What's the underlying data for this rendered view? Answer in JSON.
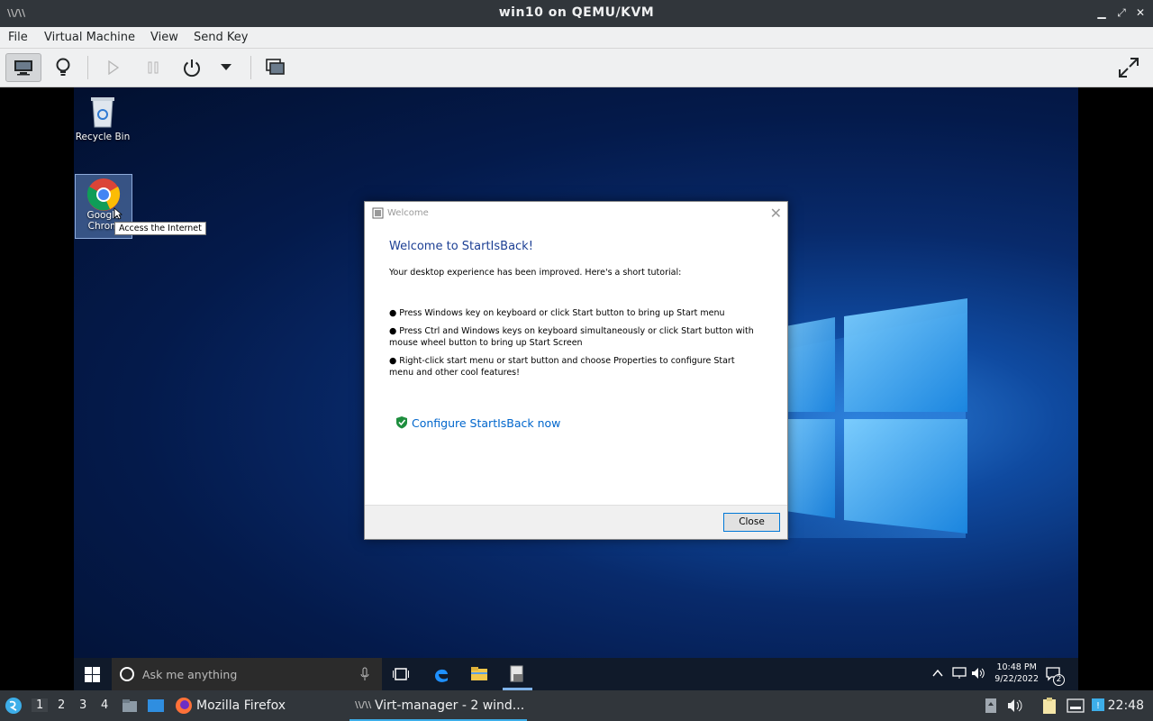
{
  "window": {
    "title": "win10 on QEMU/KVM"
  },
  "menubar": {
    "items": [
      "File",
      "Virtual Machine",
      "View",
      "Send Key"
    ]
  },
  "desktop": {
    "icons": [
      {
        "label": "Recycle Bin"
      },
      {
        "label": "Google Chrome",
        "label_line1": "Google",
        "label_line2": "Chrom"
      }
    ],
    "tooltip": "Access the Internet"
  },
  "dialog": {
    "title": "Welcome",
    "heading": "Welcome to StartIsBack!",
    "intro": "Your desktop experience has been improved. Here's a short tutorial:",
    "bullets": [
      "● Press Windows key on keyboard or click Start button to bring up Start menu",
      "● Press Ctrl and Windows keys on keyboard simultaneously or click Start button with mouse wheel button to bring up Start Screen",
      "● Right-click start menu or start button and choose Properties to configure Start menu and other cool features!"
    ],
    "link": "Configure StartIsBack now",
    "close_label": "Close"
  },
  "win_taskbar": {
    "search_placeholder": "Ask me anything",
    "time": "10:48 PM",
    "date": "9/22/2022",
    "notification_count": "2"
  },
  "host_panel": {
    "workspaces": [
      "1",
      "2",
      "3",
      "4"
    ],
    "current_workspace": "1",
    "tasks": [
      {
        "label": "Mozilla Firefox"
      },
      {
        "label": "Virt-manager - 2 wind..."
      }
    ],
    "clock": "22:48"
  },
  "colors": {
    "accent": "#3daee9",
    "dialog_heading": "#1c3f94",
    "link": "#0066cc"
  }
}
